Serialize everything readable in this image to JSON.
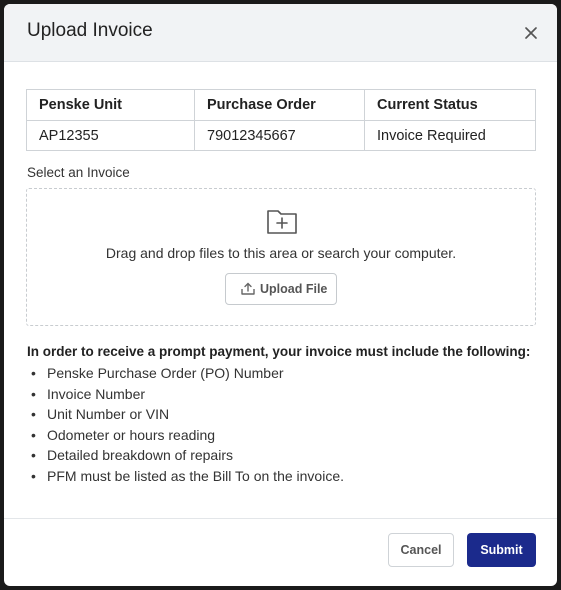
{
  "modal": {
    "title": "Upload Invoice",
    "close_icon": "close-icon"
  },
  "table": {
    "headers": [
      "Penske Unit",
      "Purchase Order",
      "Current Status"
    ],
    "rows": [
      [
        "AP12355",
        "79012345667",
        "Invoice Required"
      ]
    ]
  },
  "upload": {
    "label": "Select an Invoice",
    "folder_icon": "folder-plus-icon",
    "drop_text": "Drag and drop files to this area or search your computer.",
    "button_icon": "upload-icon",
    "button_label": "Upload File"
  },
  "requirements": {
    "heading": "In order to receive a prompt payment, your invoice must include the following:",
    "items": [
      "Penske Purchase Order (PO) Number",
      "Invoice Number",
      "Unit Number or VIN",
      "Odometer or hours reading",
      "Detailed breakdown of repairs",
      "PFM must be listed as the Bill To on the invoice."
    ]
  },
  "footer": {
    "cancel_label": "Cancel",
    "submit_label": "Submit"
  },
  "colors": {
    "primary": "#1b2a8c",
    "header_bg": "#f1f3f5"
  }
}
